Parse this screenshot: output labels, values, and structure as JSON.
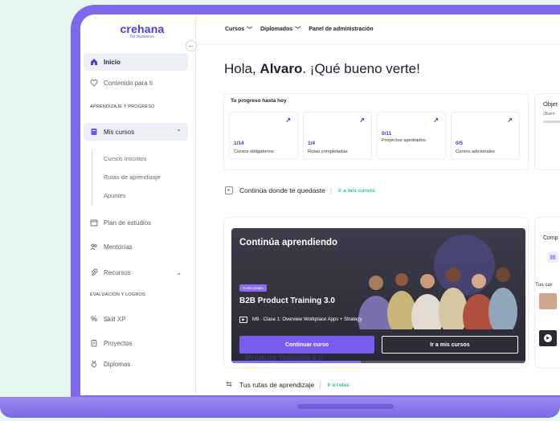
{
  "brand": {
    "name": "crehana",
    "tagline": "for business"
  },
  "sidebar": {
    "collapse_glyph": "←",
    "items": [
      {
        "label": "Inicio",
        "icon": "home-icon"
      },
      {
        "label": "Contenido para ti",
        "icon": "heart-icon"
      }
    ],
    "section_learning": "APRENDIZAJE Y PROGRESO",
    "mis_cursos": {
      "label": "Mis cursos",
      "icon": "book-icon"
    },
    "mis_cursos_sub": [
      "Cursos inscritos",
      "Rutas de aprendizaje",
      "Apuntes"
    ],
    "more_items": [
      {
        "label": "Plan de estudios",
        "icon": "calendar-icon"
      },
      {
        "label": "Mentorías",
        "icon": "people-icon"
      },
      {
        "label": "Recursos",
        "icon": "paperclip-icon"
      }
    ],
    "section_eval": "EVALUACIÓN Y LOGROS",
    "eval_items": [
      {
        "label": "Skill XP",
        "icon": "percent-icon"
      },
      {
        "label": "Proyectos",
        "icon": "clipboard-icon"
      },
      {
        "label": "Diplomas",
        "icon": "medal-icon"
      }
    ]
  },
  "topbar": {
    "nav": [
      {
        "label": "Cursos"
      },
      {
        "label": "Diplomados"
      },
      {
        "label": "Panel de administración"
      }
    ]
  },
  "greeting": {
    "prefix": "Hola, ",
    "name": "Alvaro",
    "suffix": ". ¡Qué bueno verte!"
  },
  "progress": {
    "title": "Tu progreso hasta hoy",
    "stats": [
      {
        "value": "1/14",
        "label": "Cursos obligatorios"
      },
      {
        "value": "1/4",
        "label": "Rutas completadas"
      },
      {
        "value": "0/11",
        "label": "Proyectos aprobados"
      },
      {
        "value": "0/5",
        "label": "Cursos adicionales"
      }
    ]
  },
  "objectives": {
    "title": "Objet",
    "subtitle": "¡Buen"
  },
  "continue_section": {
    "title": "Continúa donde te quedaste",
    "link": "Ir a mis cursos"
  },
  "course": {
    "heading": "Continúa aprendiendo",
    "tag": "Curso propio",
    "name": "B2B Product Training 3.0",
    "lesson": "M9 · Clase 1: Overview Workplace Apps + Strategy",
    "primary_button": "Continuar curso",
    "secondary_button": "Ir a mis cursos",
    "progress_fraction": 0.44,
    "ghost_text": "Product Training 3.0"
  },
  "companion": {
    "title": "Comp",
    "tus_label": "Tus cur"
  },
  "routes_section": {
    "title": "Tus rutas de aprendizaje",
    "link": "Ir a rutas"
  },
  "colors": {
    "brand": "#4b3be0",
    "accent": "#7a5cf0",
    "link": "#2ec39c",
    "frame": "#7d69ea"
  }
}
